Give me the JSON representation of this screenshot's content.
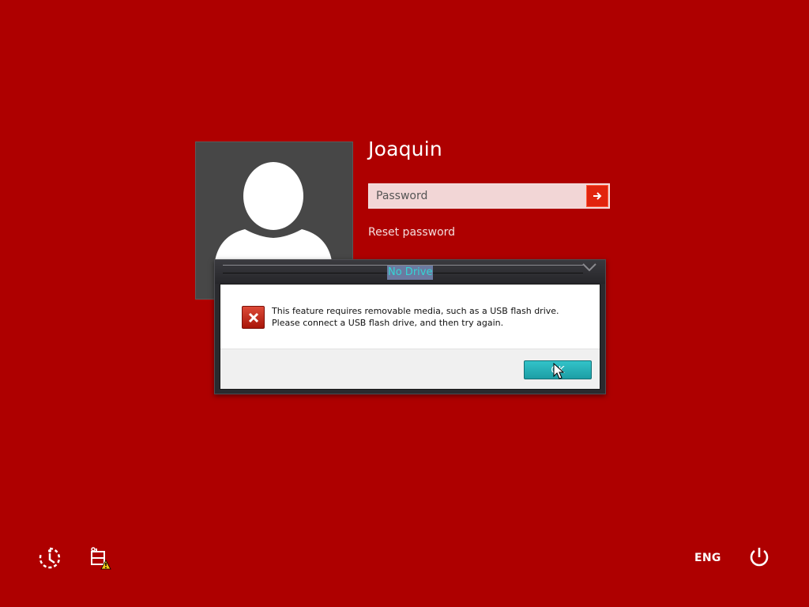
{
  "user": {
    "name": "Joaquin"
  },
  "password": {
    "placeholder": "Password",
    "value": ""
  },
  "links": {
    "reset_password": "Reset password"
  },
  "dialog": {
    "title": "No Drive",
    "message": "This feature requires removable media, such as a USB flash drive. Please connect a USB flash drive, and then try again.",
    "ok_label": "OK"
  },
  "bottom_bar": {
    "language": "ENG"
  },
  "icons": {
    "avatar": "user-silhouette-icon",
    "submit": "arrow-right-icon",
    "error": "error-x-icon",
    "ease_of_access": "ease-of-access-icon",
    "network": "network-warning-icon",
    "power": "power-icon"
  },
  "colors": {
    "background": "#ae0000",
    "accent_button": "#e1240e",
    "dialog_ok": "#1d9ea5"
  }
}
